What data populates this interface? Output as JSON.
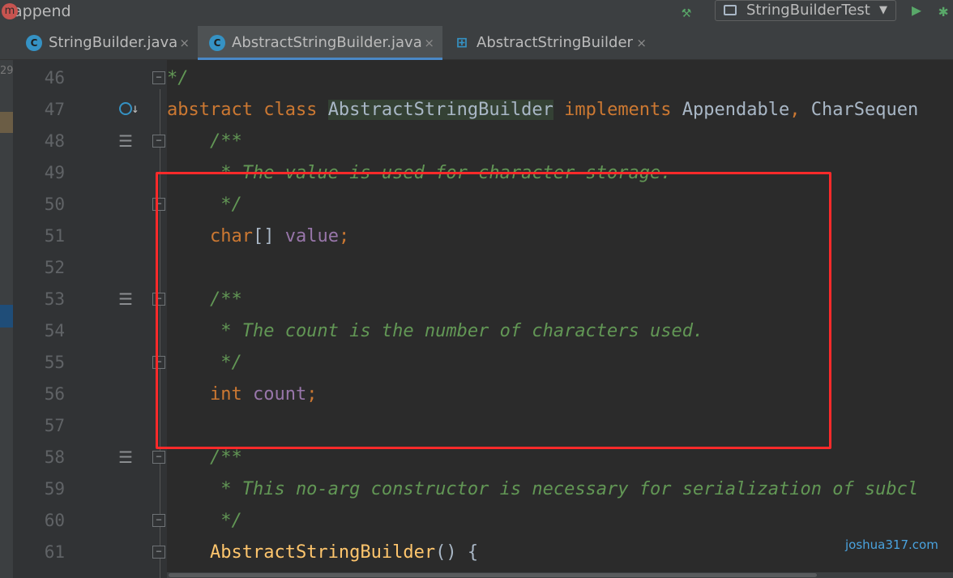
{
  "breadcrumb": {
    "method": "append",
    "icon": "method-icon"
  },
  "toolbar": {
    "run_config": "StringBuilderTest"
  },
  "tabs": [
    {
      "label": "StringBuilder.java",
      "close": "×",
      "icon": "java-class-icon"
    },
    {
      "label": "AbstractStringBuilder.java",
      "close": "×",
      "icon": "java-class-icon"
    },
    {
      "label": "AbstractStringBuilder",
      "close": "×",
      "icon": "hierarchy-icon"
    }
  ],
  "left_sidebar": {
    "partial_text": "29"
  },
  "lines": [
    {
      "n": "46",
      "code": [
        {
          "t": "*/",
          "c": "doc"
        }
      ]
    },
    {
      "n": "47",
      "code": [
        {
          "t": "abstract class ",
          "c": "kw"
        },
        {
          "t": "AbstractStringBuilder",
          "c": "cls"
        },
        {
          "t": " implements ",
          "c": "kw"
        },
        {
          "t": "Appendable",
          "c": ""
        },
        {
          "t": ", ",
          "c": "kw"
        },
        {
          "t": "CharSequen",
          "c": ""
        }
      ]
    },
    {
      "n": "48",
      "code": [
        {
          "t": "    /**",
          "c": "doc"
        }
      ]
    },
    {
      "n": "49",
      "code": [
        {
          "t": "     * The value is used for character storage.",
          "c": "doc"
        }
      ]
    },
    {
      "n": "50",
      "code": [
        {
          "t": "     */",
          "c": "doc"
        }
      ]
    },
    {
      "n": "51",
      "code": [
        {
          "t": "    ",
          "c": ""
        },
        {
          "t": "char",
          "c": "kw"
        },
        {
          "t": "[] ",
          "c": ""
        },
        {
          "t": "value",
          "c": "fld"
        },
        {
          "t": ";",
          "c": "kw"
        }
      ]
    },
    {
      "n": "52",
      "code": []
    },
    {
      "n": "53",
      "code": [
        {
          "t": "    /**",
          "c": "doc"
        }
      ]
    },
    {
      "n": "54",
      "code": [
        {
          "t": "     * The count is the number of characters used.",
          "c": "doc"
        }
      ]
    },
    {
      "n": "55",
      "code": [
        {
          "t": "     */",
          "c": "doc"
        }
      ]
    },
    {
      "n": "56",
      "code": [
        {
          "t": "    ",
          "c": ""
        },
        {
          "t": "int ",
          "c": "kw"
        },
        {
          "t": "count",
          "c": "fld"
        },
        {
          "t": ";",
          "c": "kw"
        }
      ]
    },
    {
      "n": "57",
      "code": []
    },
    {
      "n": "58",
      "code": [
        {
          "t": "    /**",
          "c": "doc"
        }
      ]
    },
    {
      "n": "59",
      "code": [
        {
          "t": "     * This no-arg constructor is necessary for serialization of subcl",
          "c": "doc"
        }
      ]
    },
    {
      "n": "60",
      "code": [
        {
          "t": "     */",
          "c": "doc"
        }
      ]
    },
    {
      "n": "61",
      "code": [
        {
          "t": "    ",
          "c": ""
        },
        {
          "t": "AbstractStringBuilder",
          "c": "mth"
        },
        {
          "t": "() {",
          "c": ""
        }
      ]
    }
  ],
  "watermark": "joshua317.com"
}
